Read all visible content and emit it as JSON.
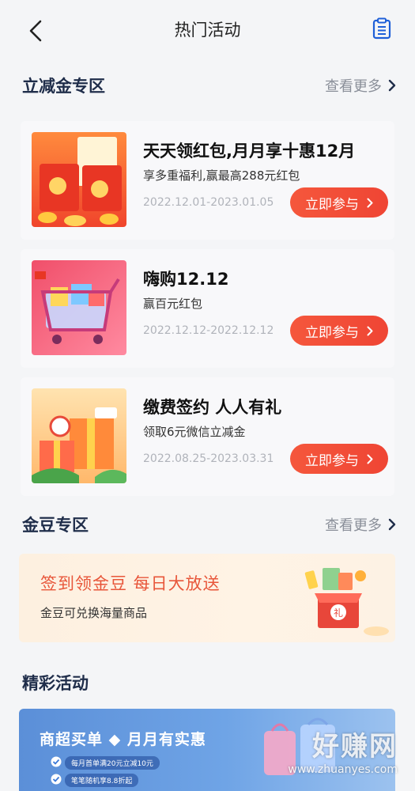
{
  "header": {
    "title": "热门活动"
  },
  "sections": {
    "discount": {
      "title": "立减金专区",
      "more": "查看更多"
    },
    "bean": {
      "title": "金豆专区",
      "more": "查看更多"
    },
    "featured": {
      "title": "精彩活动"
    }
  },
  "cards": [
    {
      "title": "天天领红包,月月享十惠12月",
      "subtitle": "享多重福利,赢最高288元红包",
      "date": "2022.12.01-2023.01.05",
      "button": "立即参与"
    },
    {
      "title": "嗨购12.12",
      "subtitle": "赢百元红包",
      "date": "2022.12.12-2022.12.12",
      "button": "立即参与"
    },
    {
      "title": "缴费签约 人人有礼",
      "subtitle": "领取6元微信立减金",
      "date": "2022.08.25-2023.03.31",
      "button": "立即参与"
    }
  ],
  "bean_banner": {
    "title": "签到领金豆  每日大放送",
    "subtitle": "金豆可兑换海量商品"
  },
  "promo_banner": {
    "title": "商超买单 ◆ 月月有实惠",
    "line1": "每月首单满20元立减10元",
    "line2": "笔笔随机享8.8折起"
  },
  "watermark": {
    "text": "好赚网",
    "url": "www.zhuanyes.com"
  },
  "colors": {
    "accent": "#ef4534",
    "title": "#1f2d4a",
    "muted": "#8a8f99"
  }
}
